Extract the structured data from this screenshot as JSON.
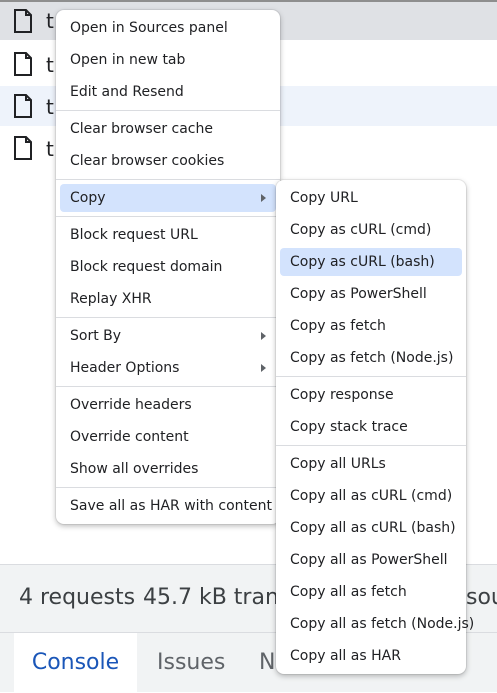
{
  "network_rows": [
    {
      "name": "t"
    },
    {
      "name": "t"
    },
    {
      "name": "t"
    },
    {
      "name": "t"
    }
  ],
  "status_bar": {
    "requests": "4 requests",
    "transferred": "45.7 kB trans",
    "resources": "sou"
  },
  "drawer_tabs": {
    "console": "Console",
    "issues": "Issues",
    "network_conditions": "N"
  },
  "context_menu": {
    "open_in_sources": "Open in Sources panel",
    "open_in_new_tab": "Open in new tab",
    "edit_and_resend": "Edit and Resend",
    "clear_cache": "Clear browser cache",
    "clear_cookies": "Clear browser cookies",
    "copy": "Copy",
    "block_url": "Block request URL",
    "block_domain": "Block request domain",
    "replay_xhr": "Replay XHR",
    "sort_by": "Sort By",
    "header_options": "Header Options",
    "override_headers": "Override headers",
    "override_content": "Override content",
    "show_all_overrides": "Show all overrides",
    "save_har": "Save all as HAR with content"
  },
  "copy_submenu": {
    "copy_url": "Copy URL",
    "copy_curl_cmd": "Copy as cURL (cmd)",
    "copy_curl_bash": "Copy as cURL (bash)",
    "copy_powershell": "Copy as PowerShell",
    "copy_fetch": "Copy as fetch",
    "copy_fetch_node": "Copy as fetch (Node.js)",
    "copy_response": "Copy response",
    "copy_stack_trace": "Copy stack trace",
    "copy_all_urls": "Copy all URLs",
    "copy_all_curl_cmd": "Copy all as cURL (cmd)",
    "copy_all_curl_bash": "Copy all as cURL (bash)",
    "copy_all_powershell": "Copy all as PowerShell",
    "copy_all_fetch": "Copy all as fetch",
    "copy_all_fetch_node": "Copy all as fetch (Node.js)",
    "copy_all_har": "Copy all as HAR"
  },
  "colors": {
    "highlight": "#d3e3fd",
    "active_tab_text": "#1a56b8",
    "selected_row": "#dfe1e5"
  },
  "icons": [
    "file-icon",
    "submenu-arrow-icon"
  ]
}
